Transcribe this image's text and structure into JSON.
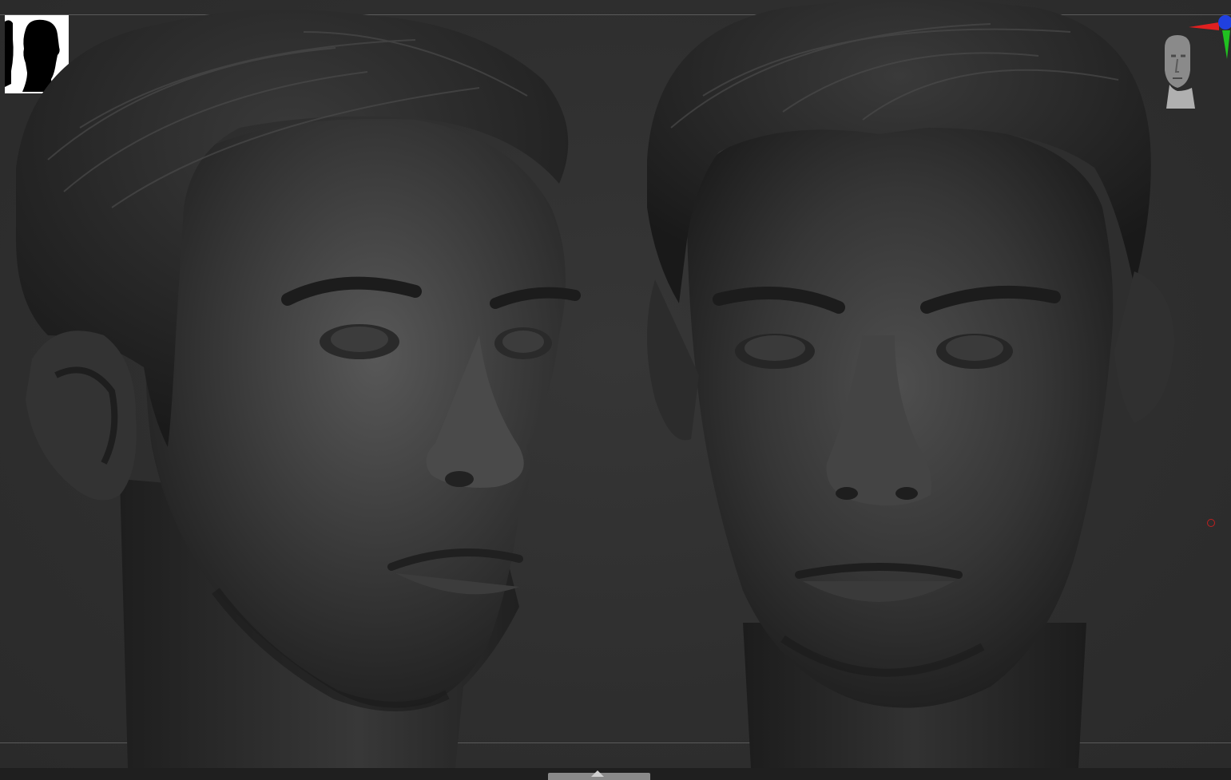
{
  "app": {
    "background_color": "#2f2f2f",
    "guide_line_color": "#5a5a5a",
    "bottom_bar_color": "#1f1f1f"
  },
  "thumbnail": {
    "icon": "head-silhouette-thumbnail",
    "background_color": "#ffffff",
    "silhouette_color": "#000000"
  },
  "viewport": {
    "views": [
      {
        "id": "three-quarter-view",
        "icon": "sculpted-head-three-quarter"
      },
      {
        "id": "front-view",
        "icon": "sculpted-head-front"
      }
    ],
    "material_color": "#3a3a3a"
  },
  "navigation": {
    "icon": "navigation-head-icon",
    "axis_gizmo_icon": "xyz-axis-gizmo",
    "axis_colors": {
      "x": "#e02020",
      "y": "#20c020",
      "z": "#2040e0"
    }
  },
  "pivot": {
    "icon": "pivot-circle-icon",
    "color": "#c02020"
  },
  "bottom_scroll": {
    "icon": "collapse-arrow-icon"
  }
}
